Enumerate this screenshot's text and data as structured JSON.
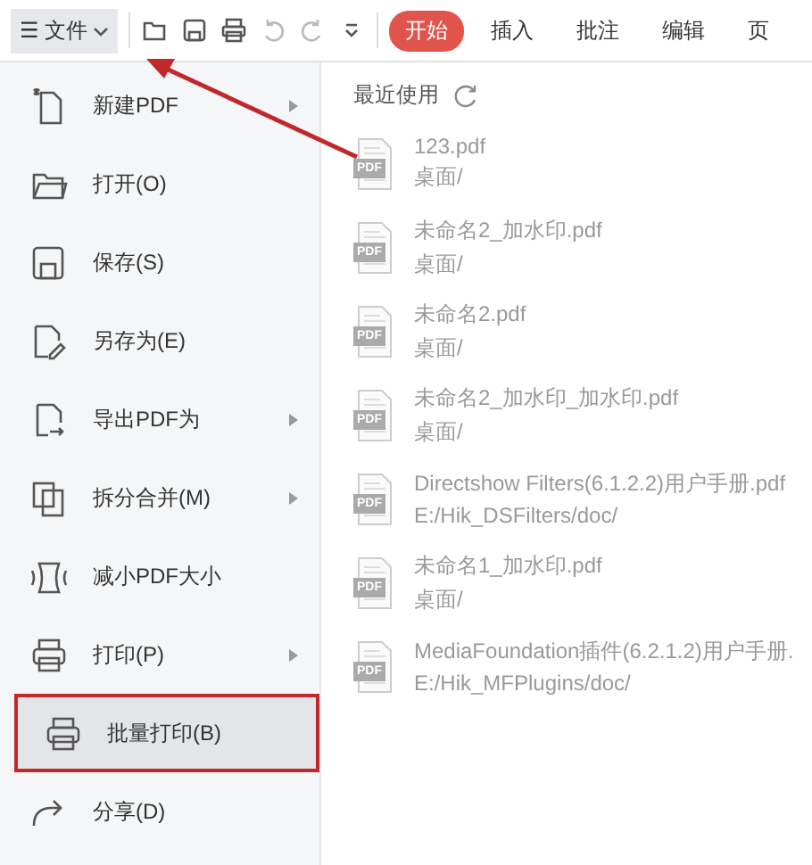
{
  "toolbar": {
    "menu_button": {
      "icon": "☰",
      "label": "文件",
      "selected": true
    },
    "tabs": [
      {
        "label": "开始",
        "selected": true
      },
      {
        "label": "插入",
        "selected": false
      },
      {
        "label": "批注",
        "selected": false
      },
      {
        "label": "编辑",
        "selected": false
      },
      {
        "label": "页",
        "selected": false
      }
    ]
  },
  "file_menu": {
    "items": [
      {
        "label": "新建PDF",
        "submenu": true,
        "selected": false,
        "highlighted": false
      },
      {
        "label": "打开(O)",
        "submenu": false,
        "selected": false,
        "highlighted": false
      },
      {
        "label": "保存(S)",
        "submenu": false,
        "selected": false,
        "highlighted": false
      },
      {
        "label": "另存为(E)",
        "submenu": false,
        "selected": false,
        "highlighted": false
      },
      {
        "label": "导出PDF为",
        "submenu": true,
        "selected": false,
        "highlighted": false
      },
      {
        "label": "拆分合并(M)",
        "submenu": true,
        "selected": false,
        "highlighted": false
      },
      {
        "label": "减小PDF大小",
        "submenu": false,
        "selected": false,
        "highlighted": false
      },
      {
        "label": "打印(P)",
        "submenu": true,
        "selected": false,
        "highlighted": false
      },
      {
        "label": "批量打印(B)",
        "submenu": false,
        "selected": true,
        "highlighted": true
      },
      {
        "label": "分享(D)",
        "submenu": false,
        "selected": false,
        "highlighted": false
      }
    ]
  },
  "recent": {
    "title": "最近使用",
    "files": [
      {
        "name": "123.pdf",
        "path": "桌面/",
        "badge": "PDF"
      },
      {
        "name": "未命名2_加水印.pdf",
        "path": "桌面/",
        "badge": "PDF"
      },
      {
        "name": "未命名2.pdf",
        "path": "桌面/",
        "badge": "PDF"
      },
      {
        "name": "未命名2_加水印_加水印.pdf",
        "path": "桌面/",
        "badge": "PDF"
      },
      {
        "name": "Directshow Filters(6.1.2.2)用户手册.pdf",
        "path": "E:/Hik_DSFilters/doc/",
        "badge": "PDF"
      },
      {
        "name": "未命名1_加水印.pdf",
        "path": "桌面/",
        "badge": "PDF"
      },
      {
        "name": "MediaFoundation插件(6.2.1.2)用户手册.",
        "path": "E:/Hik_MFPlugins/doc/",
        "badge": "PDF"
      }
    ]
  },
  "annotation": {
    "arrow": true
  }
}
